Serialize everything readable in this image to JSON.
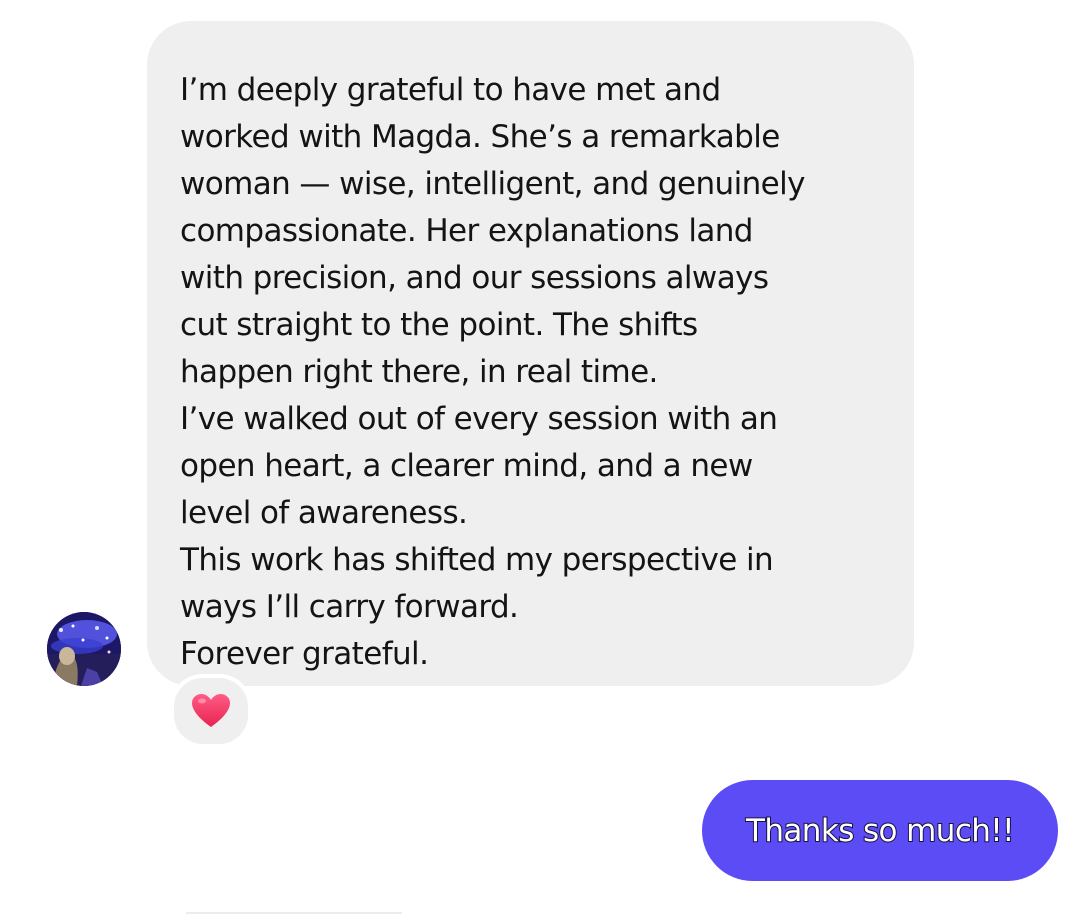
{
  "conversation": {
    "incoming_message": {
      "lines": [
        "I’m deeply grateful to have met and",
        "worked with Magda. She’s a remarkable",
        "woman — wise, intelligent, and genuinely",
        "compassionate. Her explanations land",
        "with precision, and our sessions always",
        "cut straight to the point. The shifts",
        "happen right there, in real time.",
        "I’ve walked out of every session with an",
        "open heart, a clearer mind, and a new",
        "level of awareness.",
        "This work has shifted my perspective in",
        "ways I’ll carry forward.",
        "Forever grateful."
      ],
      "reaction": "heart-icon"
    },
    "outgoing_message": {
      "text": "Thanks so much!!"
    }
  },
  "colors": {
    "incoming_bubble": "#efefef",
    "outgoing_bubble": "#5b4cf5",
    "reaction_heart": "#f4406b",
    "text": "#141414"
  }
}
